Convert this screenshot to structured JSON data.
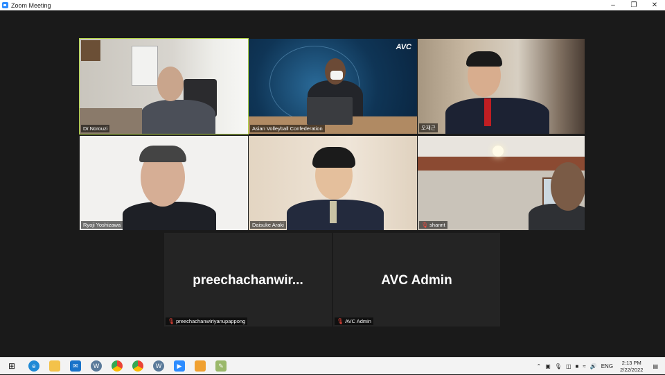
{
  "window": {
    "title": "Zoom Meeting",
    "minimize": "–",
    "restore": "❐",
    "close": "✕"
  },
  "participants": [
    {
      "name": "Dr.Norouzi",
      "muted": false,
      "active": true
    },
    {
      "name": "Asian Volleyball Confederation",
      "muted": false,
      "active": false,
      "logo_text": "AVC"
    },
    {
      "name": "오재근",
      "muted": false,
      "active": false
    },
    {
      "name": "Ryoji Yoshizawa",
      "muted": false,
      "active": false
    },
    {
      "name": "Daisuke Araki",
      "muted": false,
      "active": false
    },
    {
      "name": "shanrit",
      "muted": true,
      "active": false
    },
    {
      "name": "preechachanwiriyanupappong",
      "display_name": "preechachanwir...",
      "muted": true,
      "video_off": true
    },
    {
      "name": "AVC Admin",
      "display_name": "AVC Admin",
      "muted": true,
      "video_off": true
    }
  ],
  "taskbar": {
    "apps": [
      "windows-start-icon",
      "edge-icon",
      "file-explorer-icon",
      "mail-icon",
      "app-w-icon",
      "chrome-icon",
      "chrome-alt-icon",
      "app-w2-icon",
      "zoom-icon",
      "app-orange-icon",
      "app-pen-icon"
    ],
    "tray": {
      "language": "ENG",
      "time": "2:13 PM",
      "date": "2/22/2022"
    }
  },
  "colors": {
    "active_border": "#b6d94b",
    "muted_red": "#ff4a3d",
    "zoom_blue": "#2d8cff"
  }
}
